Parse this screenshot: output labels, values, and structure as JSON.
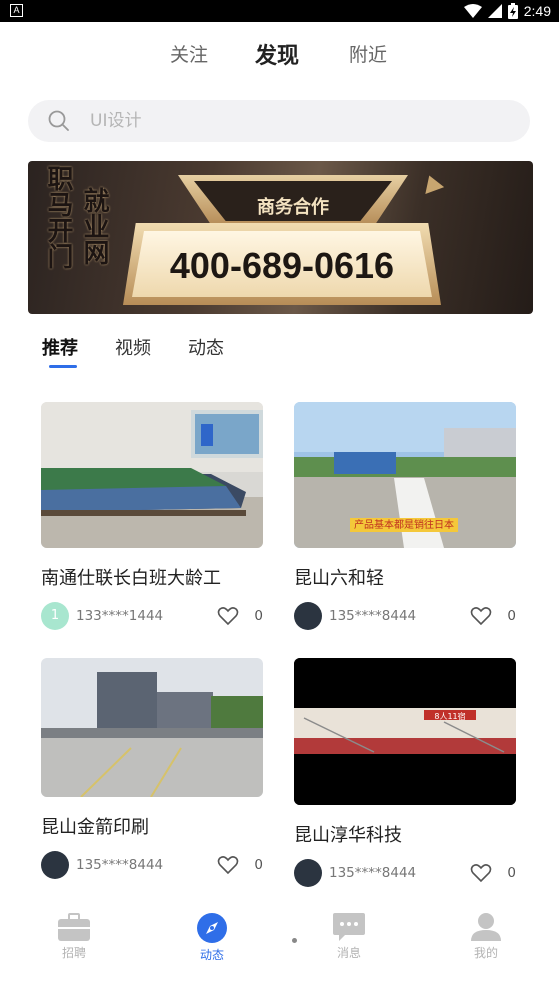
{
  "status_bar": {
    "app_badge": "A",
    "time": "2:49",
    "battery_icon": "battery-charging-icon"
  },
  "top_tabs": [
    {
      "label": "关注",
      "active": false
    },
    {
      "label": "发现",
      "active": true
    },
    {
      "label": "附近",
      "active": false
    }
  ],
  "search": {
    "placeholder": "UI设计"
  },
  "banner": {
    "vertical_text_1": "职马开门",
    "vertical_text_2": "就业网",
    "headline": "商务合作",
    "phone": "400-689-0616"
  },
  "sub_tabs": [
    {
      "label": "推荐",
      "active": true
    },
    {
      "label": "视频",
      "active": false
    },
    {
      "label": "动态",
      "active": false
    }
  ],
  "posts": [
    {
      "title": "南通仕联长白班大龄工",
      "user": "133****1444",
      "likes": "0",
      "avatar_text": "1",
      "avatar_color": "#a8e6cf"
    },
    {
      "title": "昆山六和轻",
      "user": "135****8444",
      "likes": "0",
      "overlay_caption": "产品基本都是销往日本",
      "avatar_color": "#2b3440"
    },
    {
      "title": "昆山金箭印刷",
      "user": "135****8444",
      "likes": "0",
      "avatar_color": "#2b3440"
    },
    {
      "title": "昆山淳华科技",
      "user": "135****8444",
      "likes": "0",
      "image_sign": "8人11宿",
      "avatar_color": "#2b3440"
    }
  ],
  "bottom_nav": [
    {
      "label": "招聘",
      "icon": "briefcase-icon",
      "active": false
    },
    {
      "label": "动态",
      "icon": "compass-icon",
      "active": true
    },
    {
      "label": "消息",
      "icon": "chat-bubble-icon",
      "active": false
    },
    {
      "label": "我的",
      "icon": "person-icon",
      "active": false
    }
  ],
  "colors": {
    "accent": "#2f6ee8",
    "inactive_nav": "#b3b3b3",
    "search_bg": "#f2f2f4"
  }
}
